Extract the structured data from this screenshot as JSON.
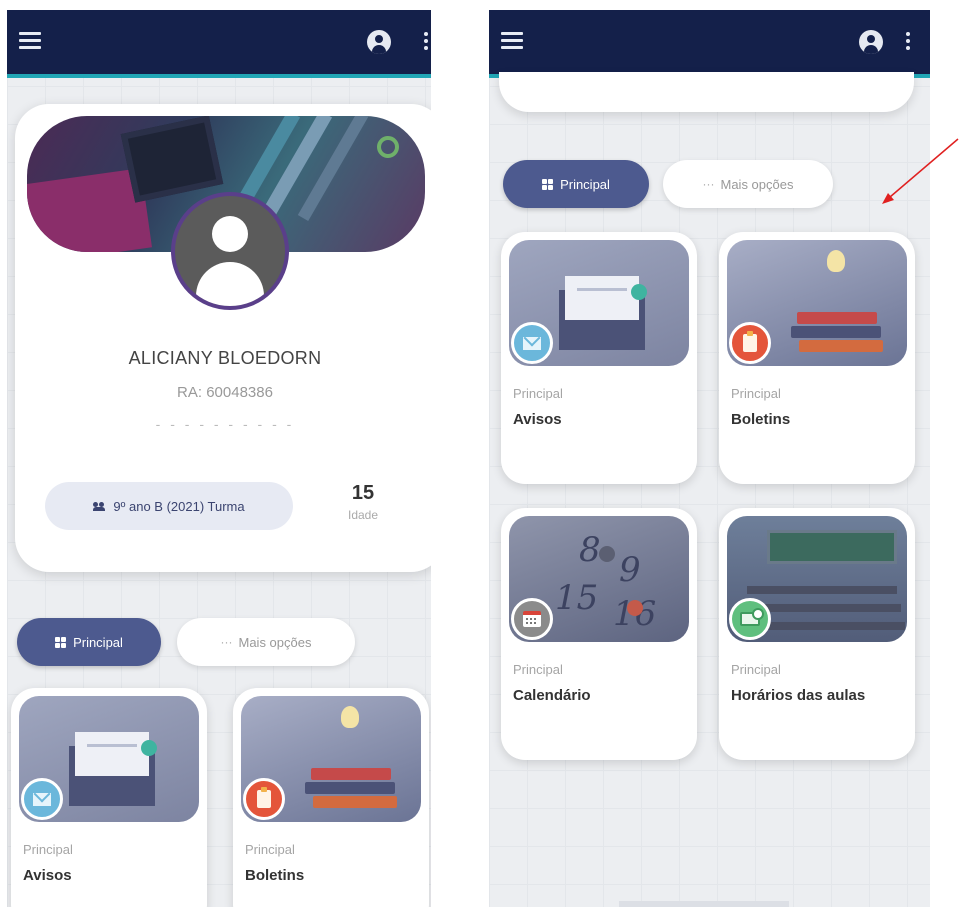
{
  "topbar": {
    "menu_icon": "hamburger-menu-icon",
    "profile_icon": "account-circle-icon",
    "more_icon": "more-vertical-icon",
    "colors": {
      "bar": "#14204a",
      "accent_line": "#21a6b5"
    }
  },
  "profile": {
    "name": "ALICIANY BLOEDORN",
    "ra": "RA: 60048386",
    "dashes": "- - - - - - - - - -",
    "class_chip": "9º ano B (2021) Turma",
    "age_value": "15",
    "age_label": "Idade"
  },
  "tabs": {
    "principal": "Principal",
    "mais_opcoes": "Mais opções",
    "colors": {
      "active": "#4d5a8f"
    }
  },
  "cards": [
    {
      "category": "Principal",
      "title": "Avisos",
      "icon": "envelope-icon"
    },
    {
      "category": "Principal",
      "title": "Boletins",
      "icon": "clipboard-icon"
    },
    {
      "category": "Principal",
      "title": "Calendário",
      "icon": "calendar-icon"
    },
    {
      "category": "Principal",
      "title": "Horários das aulas",
      "icon": "classroom-board-icon"
    }
  ],
  "annotation": {
    "arrow_color": "#e02020"
  }
}
